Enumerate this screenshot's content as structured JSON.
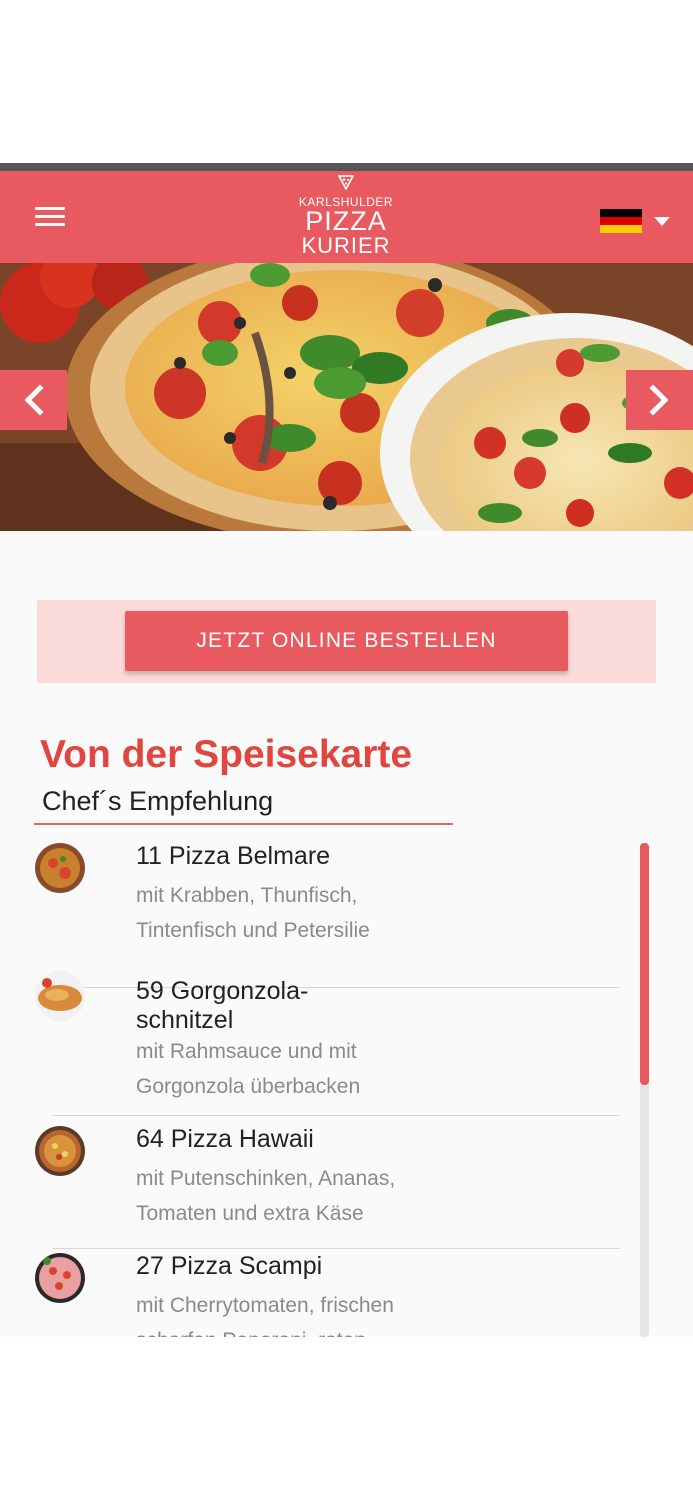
{
  "header": {
    "menu_icon": "hamburger-menu-icon",
    "logo": {
      "line1": "KARLSHULDER",
      "line2": "PIZZA",
      "line3": "KURIER"
    },
    "language": {
      "flag": "german-flag",
      "flag_colors": [
        "#000000",
        "#dd0000",
        "#ffce00"
      ],
      "dropdown_icon": "caret-down-icon"
    },
    "colors": {
      "brand": "#e85a5f"
    }
  },
  "hero": {
    "image": "pizza-photo",
    "prev_icon": "chevron-left-icon",
    "next_icon": "chevron-right-icon"
  },
  "order": {
    "button_label": "JETZT ONLINE BESTELLEN"
  },
  "menu_section": {
    "title": "Von der Speisekarte",
    "subtitle": "Chef´s Empfehlung",
    "items": [
      {
        "name": "11 Pizza Belmare",
        "description": "mit Krabben, Thunfisch, Tintenfisch und Petersilie"
      },
      {
        "name": "59 Gorgonzola-schnitzel",
        "description": "mit Rahmsauce und mit Gorgonzola überbacken"
      },
      {
        "name": "64 Pizza Hawaii",
        "description": "mit Putenschinken, Ananas, Tomaten und extra Käse"
      },
      {
        "name": "27 Pizza Scampi",
        "description": "mit Cherrytomaten, frischen scharfen Peperoni, roten"
      }
    ]
  }
}
